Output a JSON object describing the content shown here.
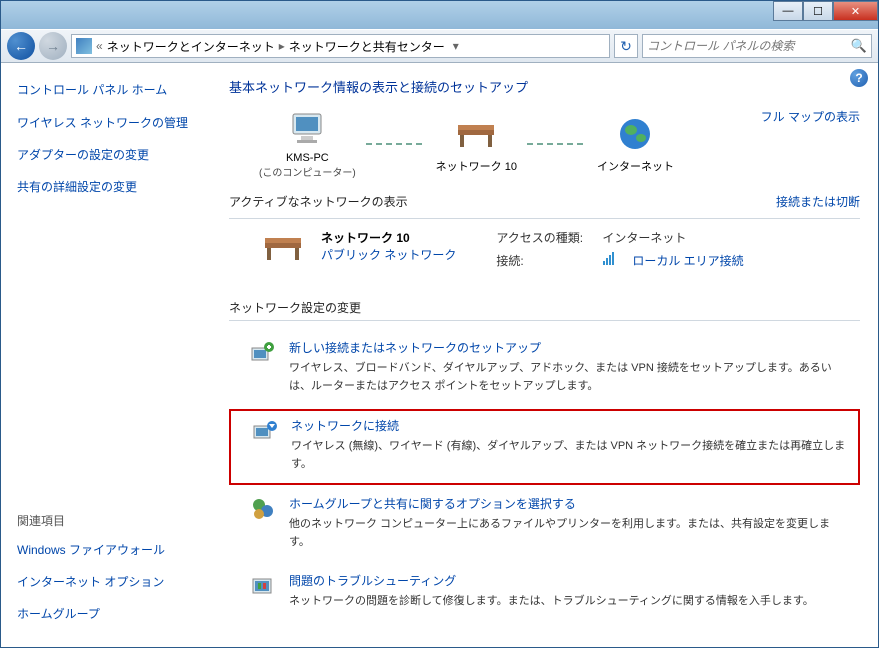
{
  "titlebar": {
    "minimize": "—",
    "maximize": "☐",
    "close": "✕"
  },
  "navbar": {
    "back_arrow": "←",
    "fwd_arrow": "→",
    "bc_sep1": "«",
    "bc_item1": "ネットワークとインターネット",
    "bc_sep2": "▸",
    "bc_item2": "ネットワークと共有センター",
    "bc_dd": "▾",
    "refresh": "↻",
    "search_placeholder": "コントロール パネルの検索",
    "search_icon": "🔍"
  },
  "help": "?",
  "sidebar": {
    "cp_home": "コントロール パネル ホーム",
    "links": [
      "ワイヤレス ネットワークの管理",
      "アダプターの設定の変更",
      "共有の詳細設定の変更"
    ],
    "related_title": "関連項目",
    "related": [
      "Windows ファイアウォール",
      "インターネット オプション",
      "ホームグループ"
    ]
  },
  "main": {
    "title": "基本ネットワーク情報の表示と接続のセットアップ",
    "fullmap": "フル マップの表示",
    "nodes": {
      "pc_name": "KMS-PC",
      "pc_sub": "(このコンピューター)",
      "net_name": "ネットワーク  10",
      "internet": "インターネット"
    },
    "active": {
      "header": "アクティブなネットワークの表示",
      "header_right": "接続または切断",
      "net_name": "ネットワーク  10",
      "net_type": "パブリック ネットワーク",
      "access_label": "アクセスの種類:",
      "access_value": "インターネット",
      "conn_label": "接続:",
      "conn_value": "ローカル エリア接続"
    },
    "settings_title": "ネットワーク設定の変更",
    "settings": [
      {
        "title": "新しい接続またはネットワークのセットアップ",
        "desc": "ワイヤレス、ブロードバンド、ダイヤルアップ、アドホック、または VPN 接続をセットアップします。あるいは、ルーターまたはアクセス ポイントをセットアップします。",
        "highlighted": false
      },
      {
        "title": "ネットワークに接続",
        "desc": "ワイヤレス (無線)、ワイヤード (有線)、ダイヤルアップ、または VPN ネットワーク接続を確立または再確立します。",
        "highlighted": true
      },
      {
        "title": "ホームグループと共有に関するオプションを選択する",
        "desc": "他のネットワーク コンピューター上にあるファイルやプリンターを利用します。または、共有設定を変更します。",
        "highlighted": false
      },
      {
        "title": "問題のトラブルシューティング",
        "desc": "ネットワークの問題を診断して修復します。または、トラブルシューティングに関する情報を入手します。",
        "highlighted": false
      }
    ]
  }
}
